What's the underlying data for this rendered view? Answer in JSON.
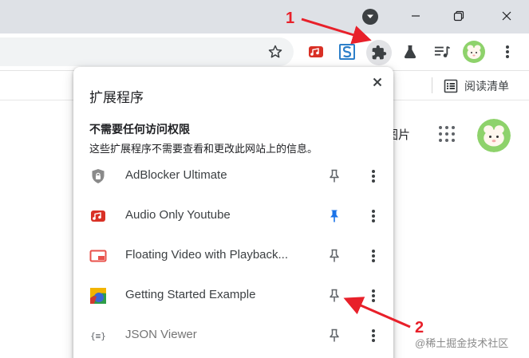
{
  "toolbar": {
    "icons": [
      "bookmark-star-icon",
      "audio-only-extension-icon",
      "s-extension-icon",
      "extensions-puzzle-icon",
      "labs-flask-icon",
      "media-control-icon",
      "profile-avatar",
      "more-vert-icon"
    ]
  },
  "bookmarks_bar": {
    "reading_list_label": "阅读清单"
  },
  "page": {
    "images_label": "图片"
  },
  "extensions_popup": {
    "title": "扩展程序",
    "section_heading": "不需要任何访问权限",
    "section_description": "这些扩展程序不需要查看和更改此网站上的信息。",
    "items": [
      {
        "name": "AdBlocker Ultimate",
        "icon": "shield-icon",
        "pinned": false,
        "dimmed": false
      },
      {
        "name": "Audio Only Youtube",
        "icon": "audio-only-icon",
        "pinned": true,
        "dimmed": false
      },
      {
        "name": "Floating Video with Playback...",
        "icon": "floating-video-icon",
        "pinned": false,
        "dimmed": false
      },
      {
        "name": "Getting Started Example",
        "icon": "color-square-icon",
        "pinned": false,
        "dimmed": false
      },
      {
        "name": "JSON Viewer",
        "icon": "json-braces-icon",
        "pinned": false,
        "dimmed": true
      }
    ]
  },
  "annotations": {
    "label_1": "1",
    "label_2": "2",
    "color": "#e8202a"
  },
  "watermark": "@稀土掘金技术社区",
  "colors": {
    "titlebar": "#dee1e6",
    "pin_active": "#1a73e8",
    "icon_gray": "#5f6368"
  }
}
